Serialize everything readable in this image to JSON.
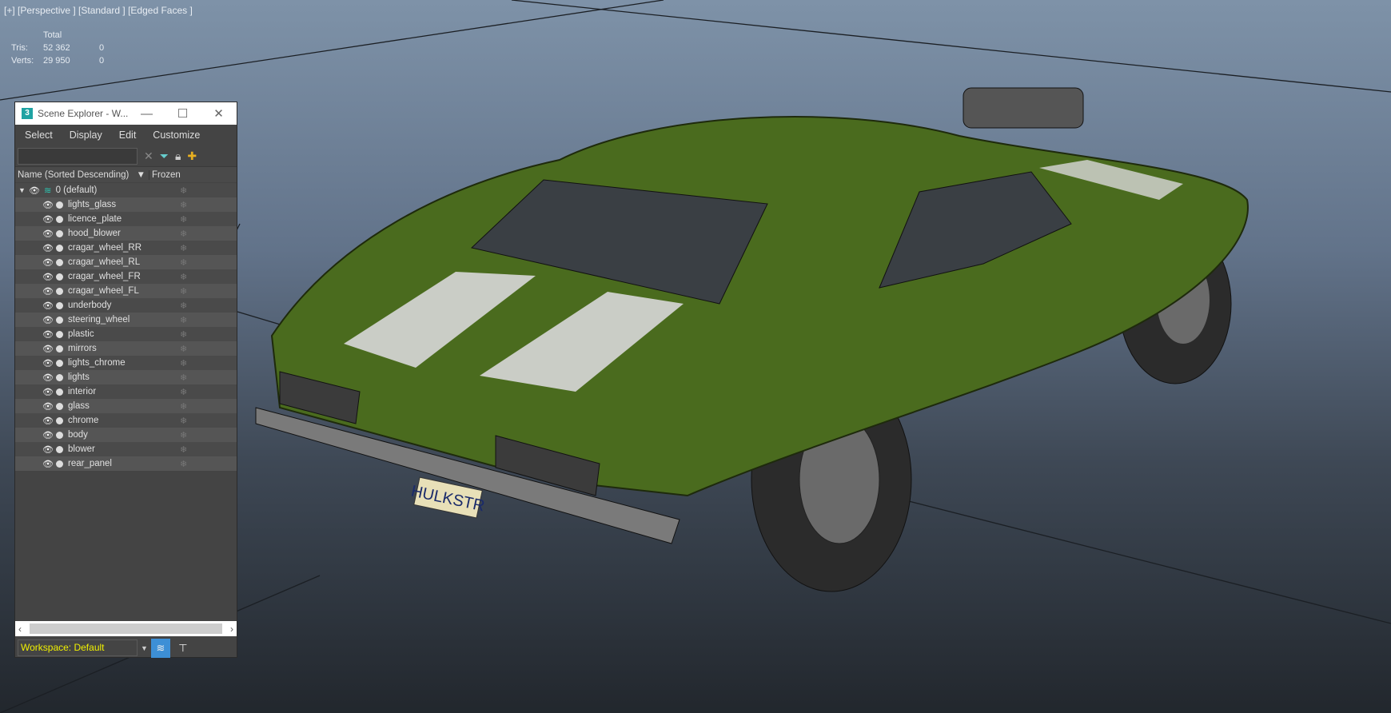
{
  "viewport": {
    "label": "[+] [Perspective ] [Standard ] [Edged Faces ]",
    "stats": {
      "header": "Total",
      "rows": [
        {
          "label": "Tris:",
          "total": "52 362",
          "sel": "0"
        },
        {
          "label": "Verts:",
          "total": "29 950",
          "sel": "0"
        }
      ]
    },
    "plate_text": "HULKSTR"
  },
  "explorer": {
    "logo": "3",
    "title": "Scene Explorer - W...",
    "menu": [
      "Select",
      "Display",
      "Edit",
      "Customize"
    ],
    "col_name": "Name (Sorted Descending)",
    "col_frozen": "Frozen",
    "layer": "0 (default)",
    "items": [
      "lights_glass",
      "licence_plate",
      "hood_blower",
      "cragar_wheel_RR",
      "cragar_wheel_RL",
      "cragar_wheel_FR",
      "cragar_wheel_FL",
      "underbody",
      "steering_wheel",
      "plastic",
      "mirrors",
      "lights_chrome",
      "lights",
      "interior",
      "glass",
      "chrome",
      "body",
      "blower",
      "rear_panel"
    ],
    "workspace": "Workspace: Default"
  },
  "colors": {
    "car": "#4a6b1e",
    "accent": "#3d8fd6",
    "workspace_text": "#f0f000"
  }
}
